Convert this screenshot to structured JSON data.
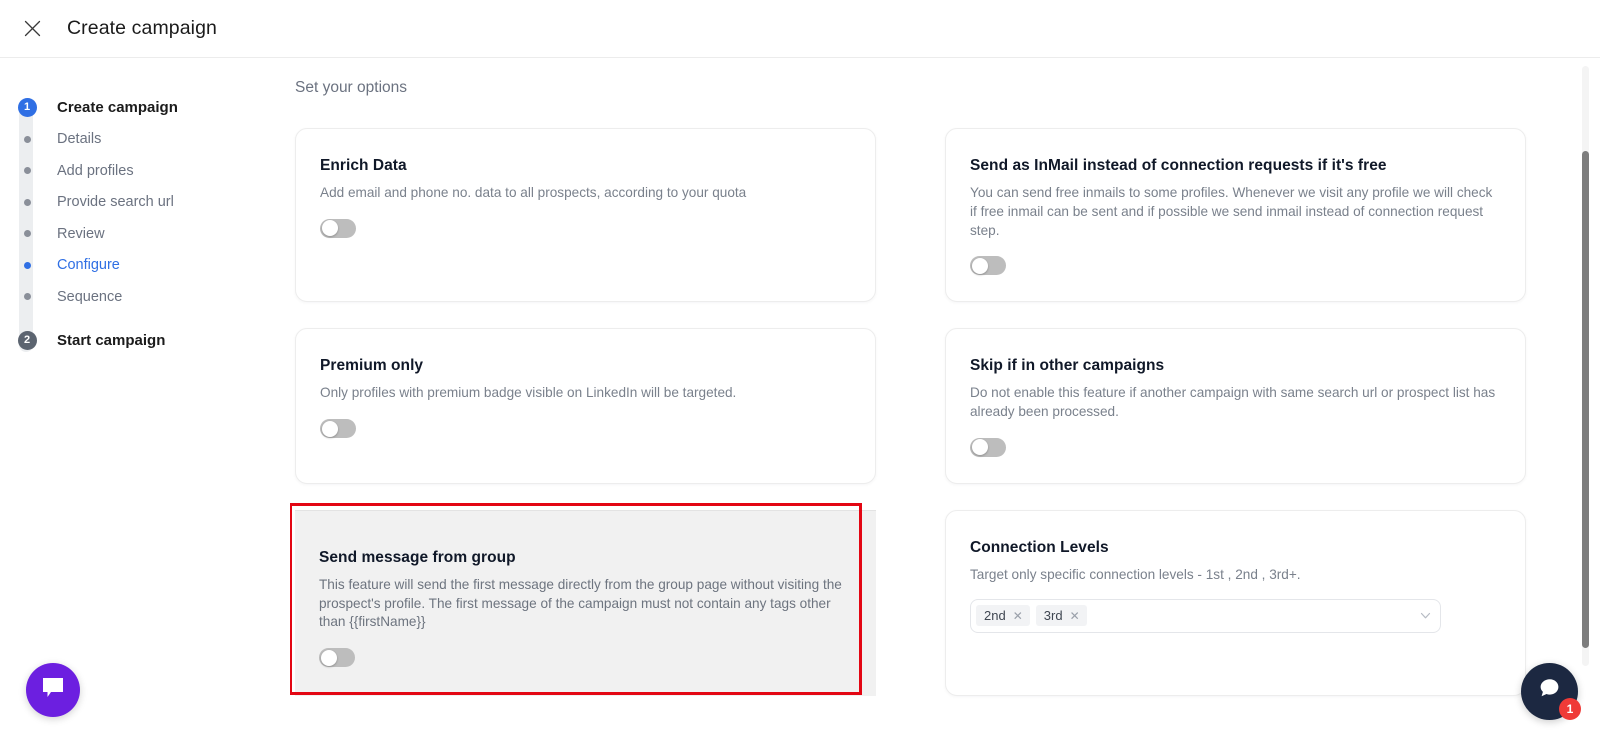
{
  "header": {
    "close_icon": "close-icon",
    "title": "Create campaign"
  },
  "sidebar": {
    "steps": [
      {
        "type": "number",
        "badge": "1",
        "label": "Create campaign",
        "state": "major"
      },
      {
        "type": "dot",
        "label": "Details",
        "state": "default"
      },
      {
        "type": "dot",
        "label": "Add profiles",
        "state": "default"
      },
      {
        "type": "dot",
        "label": "Provide search url",
        "state": "default"
      },
      {
        "type": "dot",
        "label": "Review",
        "state": "default"
      },
      {
        "type": "dot",
        "label": "Configure",
        "state": "active"
      },
      {
        "type": "dot",
        "label": "Sequence",
        "state": "default"
      },
      {
        "type": "number",
        "badge": "2",
        "label": "Start campaign",
        "state": "major"
      }
    ]
  },
  "main": {
    "section_title": "Set your options",
    "cards": [
      {
        "id": "enrich-data",
        "title": "Enrich Data",
        "desc": "Add email and phone no. data to all prospects, according to your quota",
        "control": "toggle",
        "toggle_on": false
      },
      {
        "id": "send-as-inmail",
        "title": "Send as InMail instead of connection requests if it's free",
        "desc": "You can send free inmails to some profiles. Whenever we visit any profile we will check if free inmail can be sent and if possible we send inmail instead of connection request step.",
        "control": "toggle",
        "toggle_on": false
      },
      {
        "id": "premium-only",
        "title": "Premium only",
        "desc": "Only profiles with premium badge visible on LinkedIn will be targeted.",
        "control": "toggle",
        "toggle_on": false
      },
      {
        "id": "skip-if-in-other-campaigns",
        "title": "Skip if in other campaigns",
        "desc": "Do not enable this feature if another campaign with same search url or prospect list has already been processed.",
        "control": "toggle",
        "toggle_on": false
      },
      {
        "id": "send-message-from-group",
        "title": "Send message from group",
        "desc": "This feature will send the first message directly from the group page without visiting the prospect's profile. The first message of the campaign must not contain any tags other than {{firstName}}",
        "control": "toggle",
        "toggle_on": false,
        "highlighted": true
      },
      {
        "id": "connection-levels",
        "title": "Connection Levels",
        "desc": "Target only specific connection levels - 1st , 2nd , 3rd+.",
        "control": "multiselect",
        "chips": [
          {
            "label": "2nd",
            "remove_icon": "close-icon"
          },
          {
            "label": "3rd",
            "remove_icon": "close-icon"
          }
        ],
        "caret_icon": "chevron-down-icon"
      }
    ]
  },
  "annotation": {
    "color": "#e30613",
    "target": "send-message-from-group"
  },
  "widgets": {
    "chat_left": {
      "icon": "chat-bubble-icon",
      "color": "#6c1fe0"
    },
    "chat_right": {
      "icon": "chat-bubble-icon",
      "color": "#1c2841",
      "badge": "1",
      "badge_color": "#ef3a37"
    }
  },
  "scrollbar": {
    "orientation": "vertical"
  }
}
